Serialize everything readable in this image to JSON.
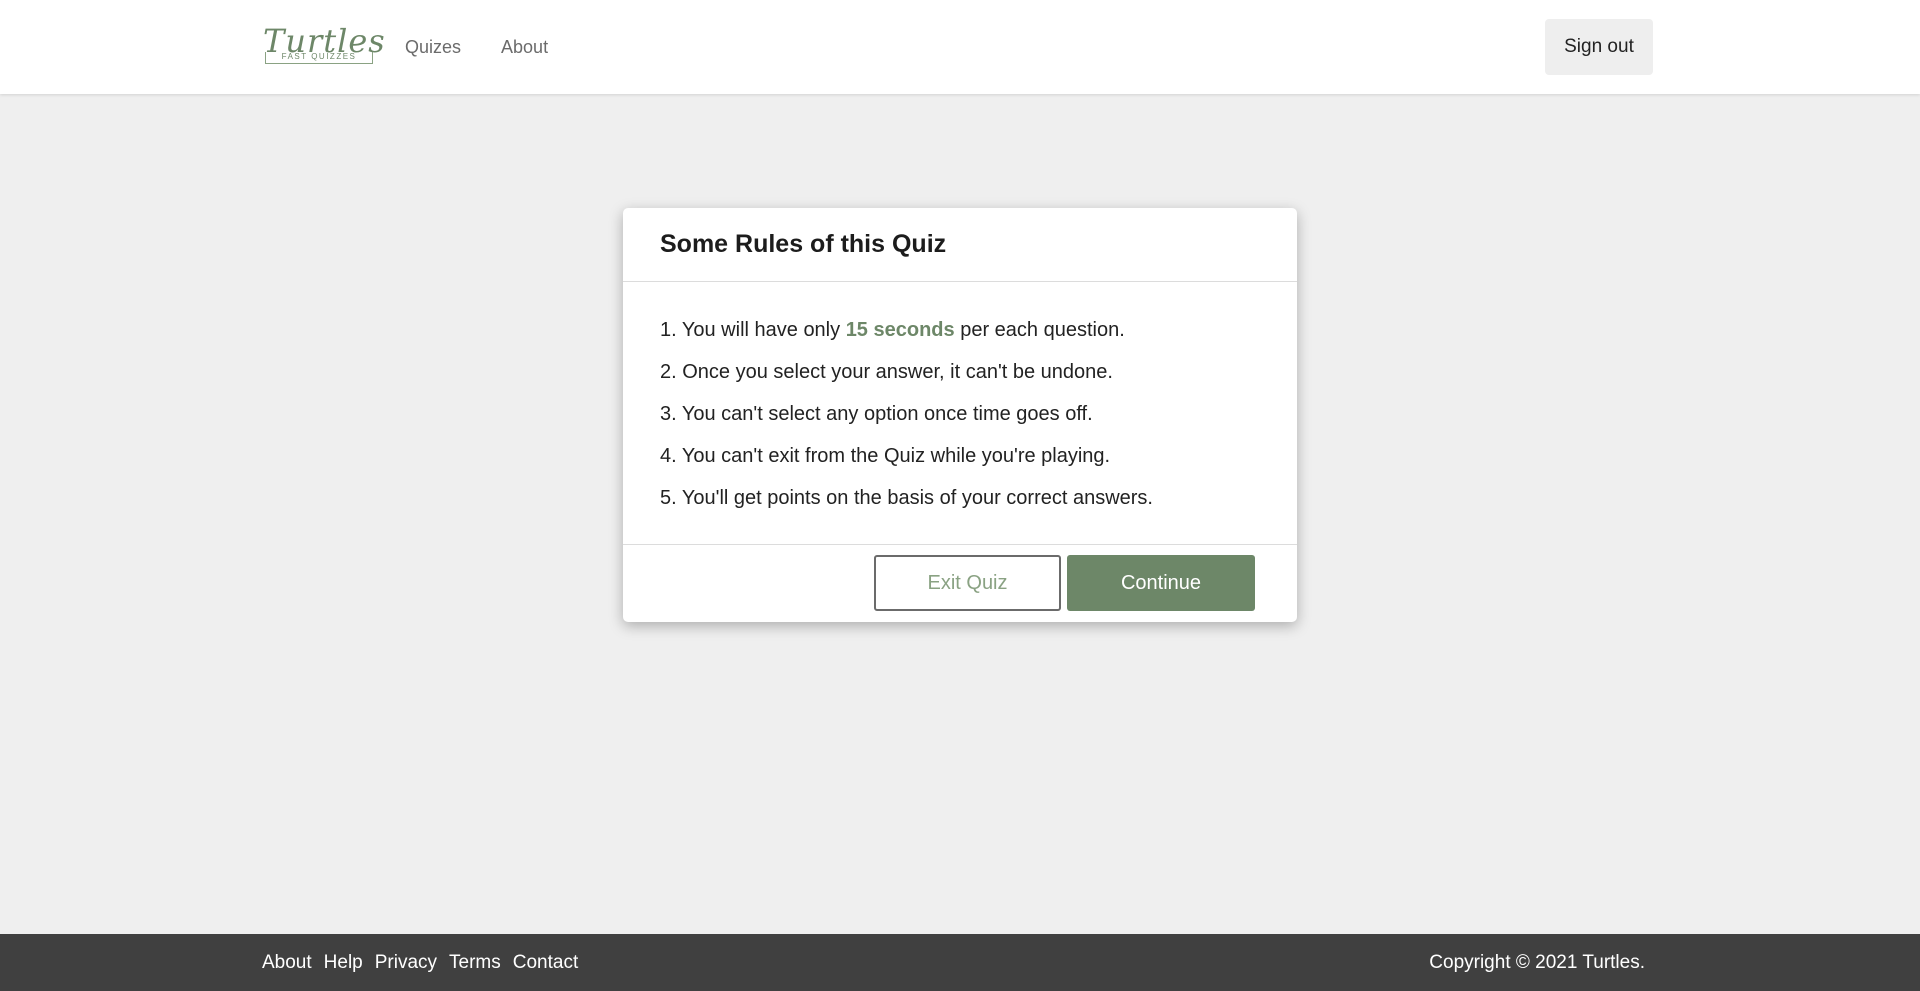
{
  "header": {
    "logo_main": "Turtles",
    "logo_sub": "FAST QUIZZES",
    "nav": [
      "Quizes",
      "About"
    ],
    "sign_out": "Sign out"
  },
  "modal": {
    "title": "Some Rules of this Quiz",
    "rules": {
      "r1_prefix": "1. You will have only ",
      "r1_highlight": "15 seconds",
      "r1_suffix": " per each question.",
      "r2": "2. Once you select your answer, it can't be undone.",
      "r3": "3. You can't select any option once time goes off.",
      "r4": "4. You can't exit from the Quiz while you're playing.",
      "r5": "5. You'll get points on the basis of your correct answers."
    },
    "exit_label": "Exit Quiz",
    "continue_label": "Continue"
  },
  "footer": {
    "links": [
      "About",
      "Help",
      "Privacy",
      "Terms",
      "Contact"
    ],
    "copyright": "Copyright © 2021 Turtles."
  },
  "colors": {
    "accent": "#6d8768",
    "page_bg": "#efefef",
    "footer_bg": "#404040"
  }
}
